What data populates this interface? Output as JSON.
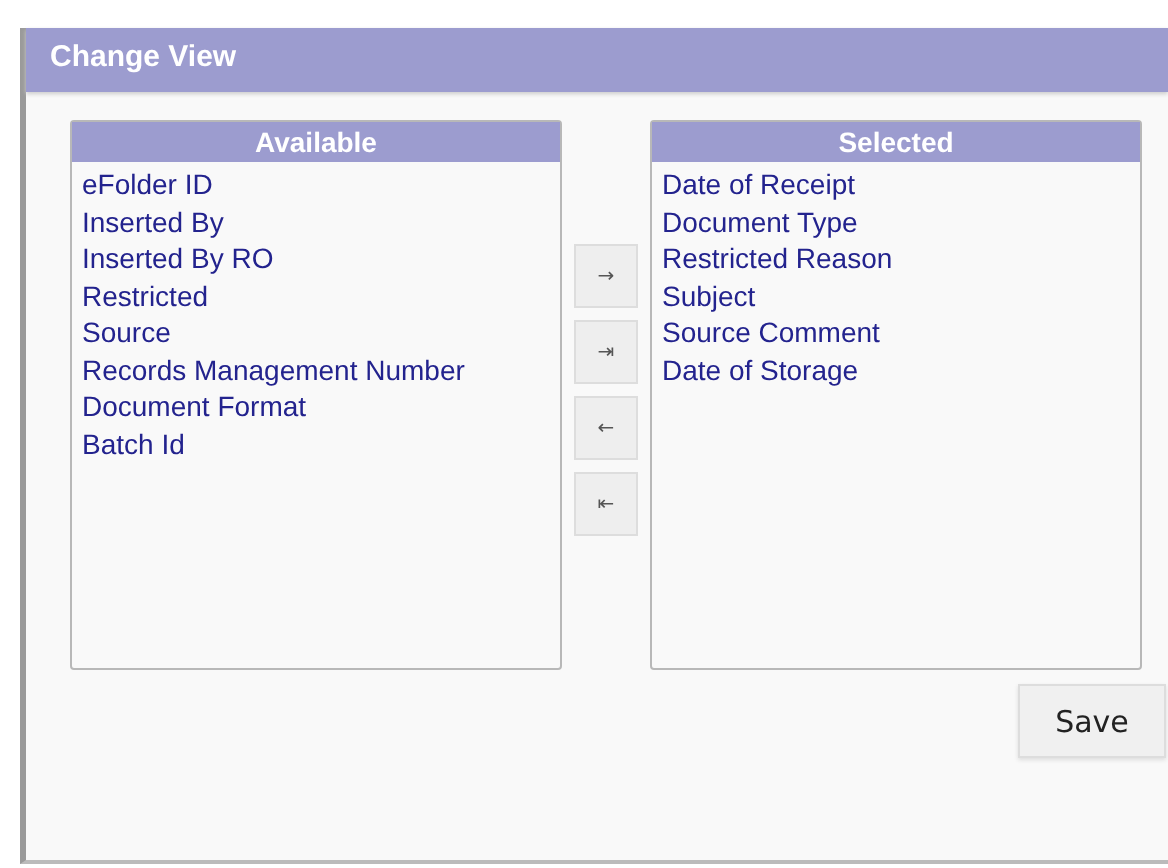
{
  "window": {
    "title": "Change View"
  },
  "available": {
    "heading": "Available",
    "items": [
      "eFolder ID",
      "Inserted By",
      "Inserted By RO",
      "Restricted",
      "Source",
      "Records Management Number",
      "Document Format",
      "Batch Id"
    ]
  },
  "move_buttons": [
    "→",
    "⇥",
    "←",
    "⇤"
  ],
  "selected": {
    "heading": "Selected",
    "items": [
      "Date of Receipt",
      "Document Type",
      "Restricted Reason",
      "Subject",
      "Source Comment",
      "Date of Storage"
    ]
  },
  "buttons": [
    "Save"
  ]
}
